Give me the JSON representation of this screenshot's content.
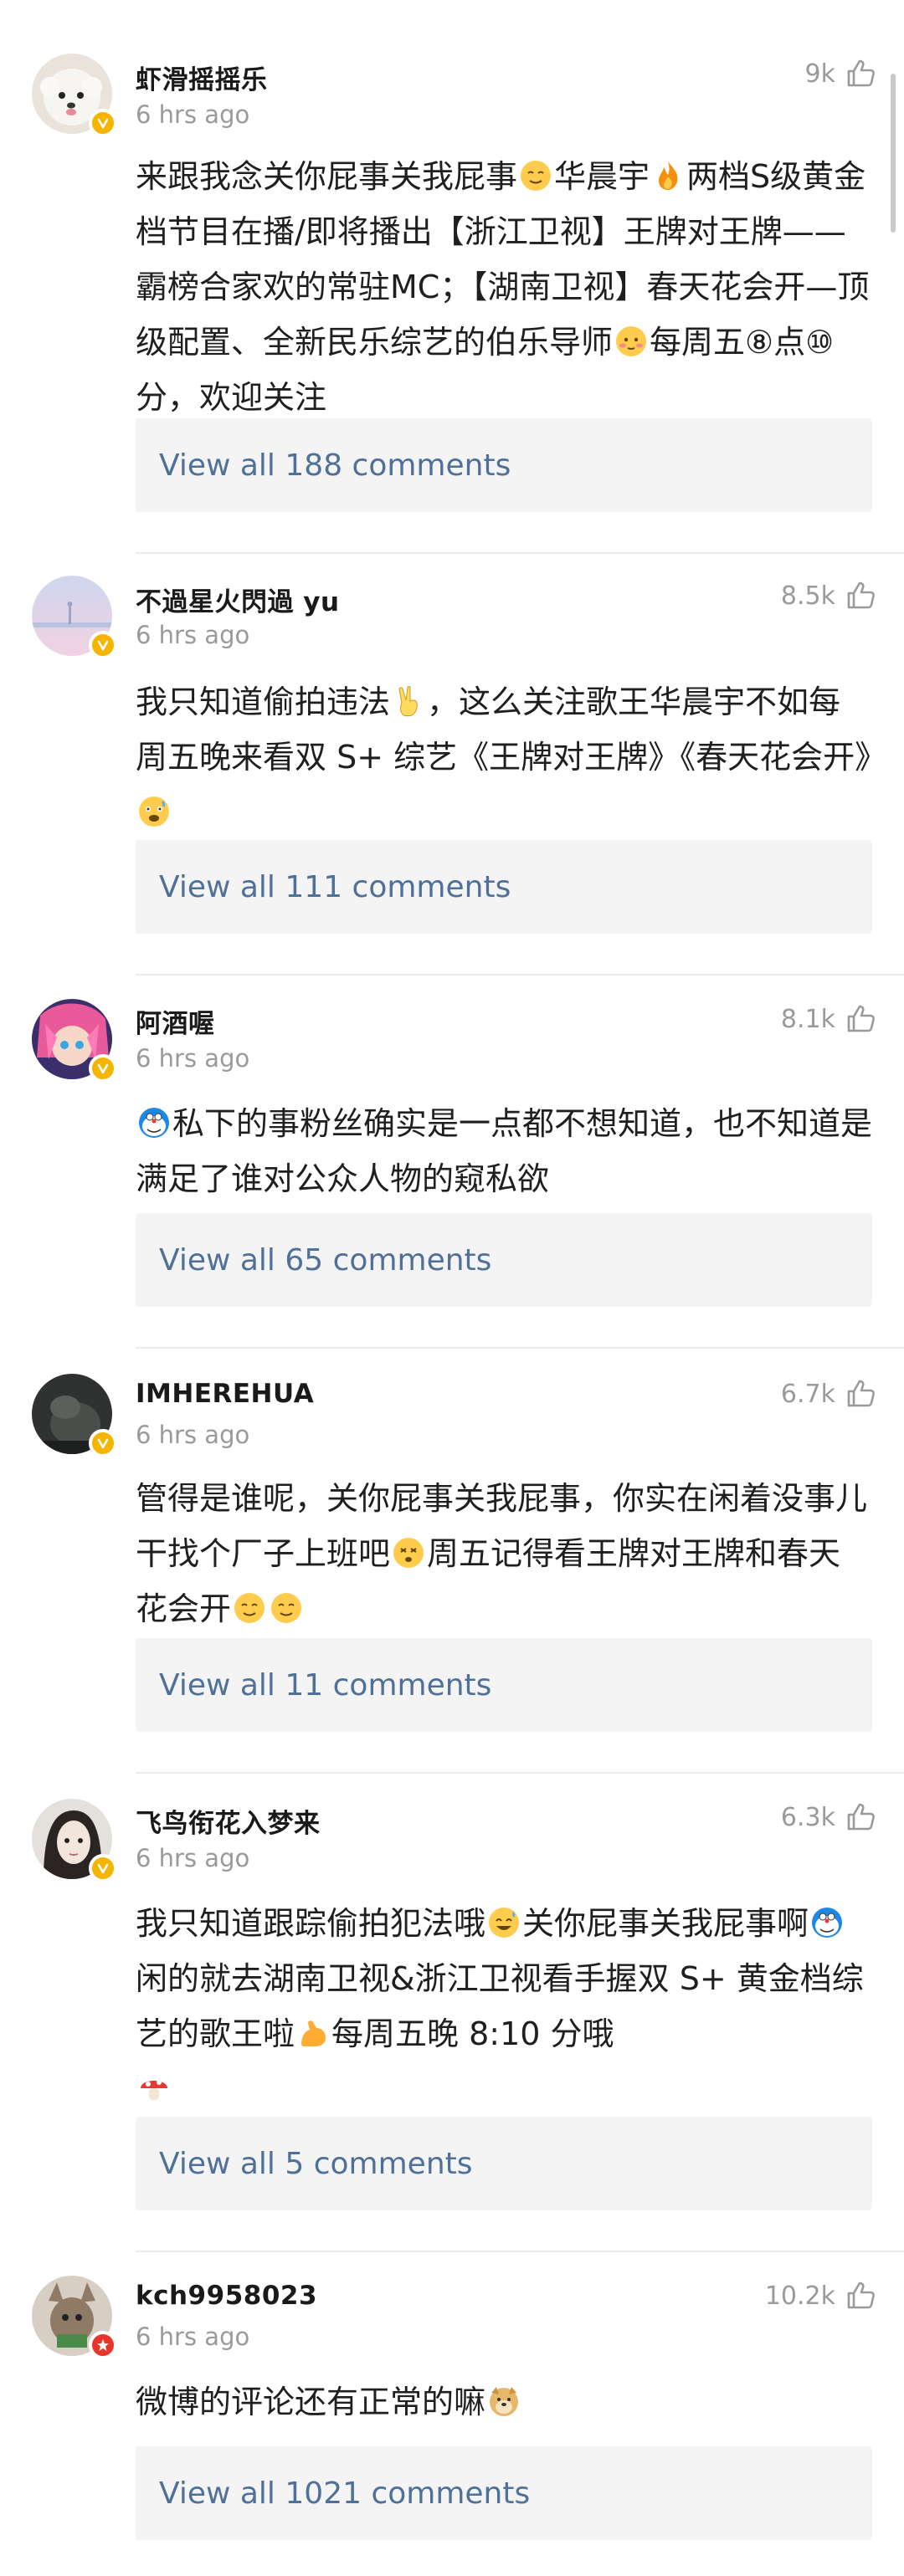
{
  "comments": [
    {
      "username": "虾滑摇摇乐",
      "time": "6 hrs ago",
      "likes": "9k",
      "text_parts": [
        "来跟我念关你屁事关我屁事",
        "华晨宇",
        "两档S级黄金档节目在播/即将播出【浙江卫视】王牌对王牌——霸榜合家欢的常驻MC；【湖南卫视】春天花会开—顶级配置、全新民乐综艺的伯乐导师",
        "每周五⑧点⑩分，欢迎关注"
      ],
      "replies": "View all 188 comments",
      "badge": "gold"
    },
    {
      "username": "不過星火閃過 yu",
      "time": "6 hrs ago",
      "likes": "8.5k",
      "text_parts": [
        "我只知道偷拍违法",
        "，这么关注歌王华晨宇不如每周五晚来看双 S+ 综艺《王牌对王牌》《春天花会开》"
      ],
      "replies": "View all 111 comments",
      "badge": "gold"
    },
    {
      "username": "阿酒喔",
      "time": "6 hrs ago",
      "likes": "8.1k",
      "text_parts": [
        "私下的事粉丝确实是一点都不想知道，也不知道是满足了谁对公众人物的窥私欲"
      ],
      "replies": "View all 65 comments",
      "badge": "gold"
    },
    {
      "username": "IMHEREHUA",
      "time": "6 hrs ago",
      "likes": "6.7k",
      "text_parts": [
        "管得是谁呢，关你屁事关我屁事，你实在闲着没事儿干找个厂子上班吧",
        "周五记得看王牌对王牌和春天花会开"
      ],
      "replies": "View all 11 comments",
      "badge": "gold"
    },
    {
      "username": "飞鸟衔花入梦来",
      "time": "6 hrs ago",
      "likes": "6.3k",
      "text_parts": [
        "我只知道跟踪偷拍犯法哦",
        "关你屁事关我屁事啊",
        "闲的就去湖南卫视&浙江卫视看手握双 S+ 黄金档综艺的歌王啦",
        "每周五晚 8:10 分哦"
      ],
      "replies": "View all 5 comments",
      "badge": "gold"
    },
    {
      "username": "kch9958023",
      "time": "6 hrs ago",
      "likes": "10.2k",
      "text_parts": [
        "微博的评论还有正常的嘛"
      ],
      "replies": "View all 1021 comments",
      "badge": "red"
    }
  ],
  "colors": {
    "link": "#4f7098",
    "muted": "#9a9a9a",
    "reply_bg": "#f4f4f4",
    "badge_gold": "#f5b400",
    "badge_red": "#e8352b"
  },
  "icons": {
    "like": "thumbs-up-outline-icon",
    "verified": "verified-v-icon"
  }
}
